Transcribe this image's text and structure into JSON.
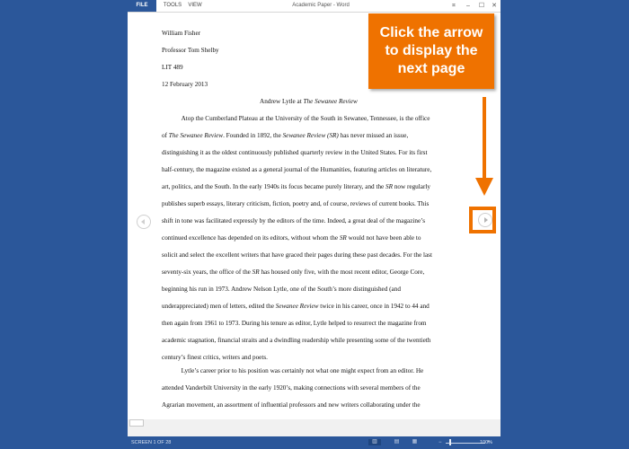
{
  "window": {
    "title": "Academic Paper - Word",
    "tabs": [
      "FILE",
      "TOOLS",
      "VIEW"
    ],
    "controls": {
      "restore": "⌘",
      "minimize": "–",
      "maximize": "☐",
      "close": "✕"
    }
  },
  "document": {
    "header_lines": [
      "William Fisher",
      "Professor Tom Shelby",
      "LIT 489",
      "12 February 2013"
    ],
    "title_plain": "Andrew Lytle at ",
    "title_italic": "The Sewanee Review",
    "body_lines": [
      [
        {
          "t": "   Atop the Cumberland Plateau at the University of the South in Sewanee, Tennessee, is the office"
        }
      ],
      [
        {
          "t": "of "
        },
        {
          "t": "The Sewanee Review",
          "i": true
        },
        {
          "t": ". Founded in 1892, the "
        },
        {
          "t": "Sewanee Review (SR)",
          "i": true
        },
        {
          "t": " has never missed an issue,"
        }
      ],
      [
        {
          "t": "distinguishing it as the oldest continuously published quarterly review in the United States. For its first"
        }
      ],
      [
        {
          "t": "half-century, the magazine existed as a general journal of the Humanities, featuring articles on literature,"
        }
      ],
      [
        {
          "t": "art, politics, and the South. In the early 1940s its focus became purely literary, and the "
        },
        {
          "t": "SR",
          "i": true
        },
        {
          "t": " now regularly"
        }
      ],
      [
        {
          "t": "publishes superb essays, literary criticism, fiction, poetry and, of course, reviews of current books. This"
        }
      ],
      [
        {
          "t": "shift in tone was facilitated expressly by the editors of the time. Indeed, a great deal of the magazine’s"
        }
      ],
      [
        {
          "t": "continued excellence has depended on its editors, without whom the "
        },
        {
          "t": "SR",
          "i": true
        },
        {
          "t": " would not have been able to"
        }
      ],
      [
        {
          "t": "solicit and select the excellent writers that have graced their pages during these past decades. For the last"
        }
      ],
      [
        {
          "t": "seventy-six years, the office of the "
        },
        {
          "t": "SR",
          "i": true
        },
        {
          "t": " has housed only five, with the most recent editor, George Core,"
        }
      ],
      [
        {
          "t": "beginning his run in 1973. Andrew Nelson Lytle, one of the South’s more distinguished (and"
        }
      ],
      [
        {
          "t": "underappreciated) men of letters, edited the "
        },
        {
          "t": "Sewanee Review",
          "i": true
        },
        {
          "t": " twice in his career, once in 1942 to 44 and"
        }
      ],
      [
        {
          "t": "then again from 1961 to 1973. During his tenure as editor, Lytle helped to resurrect the magazine from"
        }
      ],
      [
        {
          "t": "academic stagnation, financial straits and a dwindling readership while presenting some of the twentieth"
        }
      ],
      [
        {
          "t": "century’s finest critics, writers and poets."
        }
      ],
      [
        {
          "t": "   Lytle’s career prior to his position was certainly not what one might expect from an editor. He"
        }
      ],
      [
        {
          "t": "attended Vanderbilt University in the early 1920’s, making connections with several members of the"
        }
      ],
      [
        {
          "t": "Agrarian movement, an assortment of influential professors and new writers collaborating under the"
        }
      ]
    ]
  },
  "statusbar": {
    "page_indicator": "SCREEN 1 OF 28",
    "zoom_level": "100%",
    "zoom_minus": "−",
    "zoom_plus": "+",
    "zoom_fraction": 0.1
  },
  "callout": {
    "text": "Click the arrow to display the next page",
    "color": "#ef7200"
  },
  "colors": {
    "accent": "#2b579a",
    "callout": "#ef7200"
  }
}
